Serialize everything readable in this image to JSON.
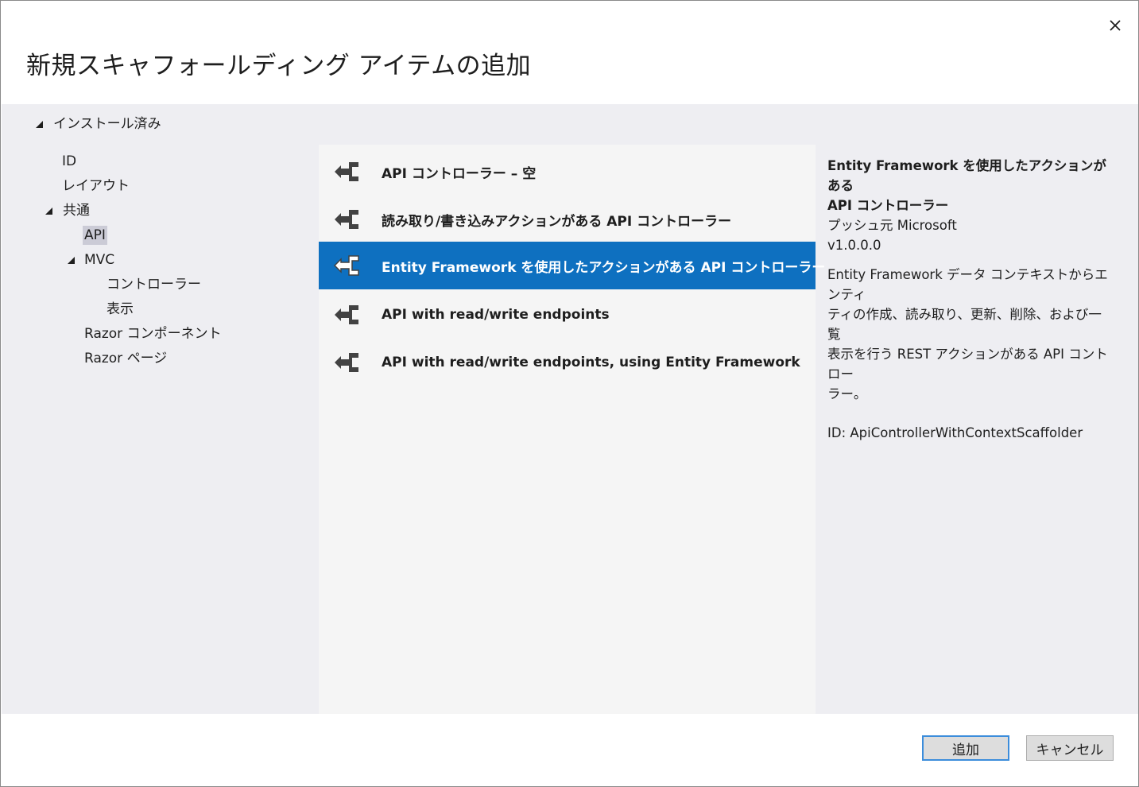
{
  "dialog": {
    "title": "新規スキャフォールディング アイテムの追加",
    "close_icon": "close-icon"
  },
  "tree": {
    "root_label": "インストール済み",
    "items": [
      {
        "label": "ID"
      },
      {
        "label": "レイアウト"
      },
      {
        "label": "共通"
      },
      {
        "label": "API"
      },
      {
        "label": "MVC"
      },
      {
        "label": "コントローラー"
      },
      {
        "label": "表示"
      },
      {
        "label": "Razor コンポーネント"
      },
      {
        "label": "Razor ページ"
      }
    ],
    "selected": "API"
  },
  "templates": [
    {
      "label": "API コントローラー – 空",
      "icon": "scaffold-icon"
    },
    {
      "label": "読み取り/書き込みアクションがある API コントローラー",
      "icon": "scaffold-icon"
    },
    {
      "label": "Entity Framework を使用したアクションがある API コントローラー",
      "icon": "scaffold-icon",
      "selected": true
    },
    {
      "label": "API with read/write endpoints",
      "icon": "scaffold-icon"
    },
    {
      "label": "API with read/write endpoints, using Entity Framework",
      "icon": "scaffold-icon"
    }
  ],
  "details": {
    "title_line1": "Entity Framework を使用したアクションがある",
    "title_line2": "API コントローラー",
    "publisher": "プッシュ元 Microsoft",
    "version": "v1.0.0.0",
    "desc_line1": "Entity Framework データ コンテキストからエンティ",
    "desc_line2": "ティの作成、読み取り、更新、削除、および一覧",
    "desc_line3": "表示を行う REST アクションがある API コントロー",
    "desc_line4": "ラー。",
    "id": "ID: ApiControllerWithContextScaffolder"
  },
  "buttons": {
    "add": "追加",
    "cancel": "キャンセル"
  },
  "colors": {
    "accent": "#0e70c0",
    "body_bg": "#eeeef2",
    "list_bg": "#f5f5f5"
  }
}
